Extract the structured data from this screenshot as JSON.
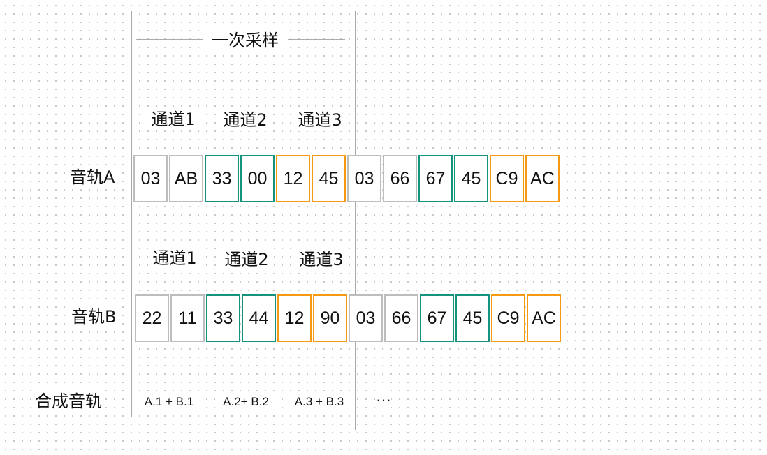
{
  "title": "一次采样",
  "channels": [
    "通道1",
    "通道2",
    "通道3"
  ],
  "tracks": [
    {
      "label": "音轨A",
      "cells": [
        {
          "value": "03",
          "channel": 1
        },
        {
          "value": "AB",
          "channel": 1
        },
        {
          "value": "33",
          "channel": 2
        },
        {
          "value": "00",
          "channel": 2
        },
        {
          "value": "12",
          "channel": 3
        },
        {
          "value": "45",
          "channel": 3
        },
        {
          "value": "03",
          "channel": 1
        },
        {
          "value": "66",
          "channel": 1
        },
        {
          "value": "67",
          "channel": 2
        },
        {
          "value": "45",
          "channel": 2
        },
        {
          "value": "C9",
          "channel": 3
        },
        {
          "value": "AC",
          "channel": 3
        }
      ]
    },
    {
      "label": "音轨B",
      "cells": [
        {
          "value": "22",
          "channel": 1
        },
        {
          "value": "11",
          "channel": 1
        },
        {
          "value": "33",
          "channel": 2
        },
        {
          "value": "44",
          "channel": 2
        },
        {
          "value": "12",
          "channel": 3
        },
        {
          "value": "90",
          "channel": 3
        },
        {
          "value": "03",
          "channel": 1
        },
        {
          "value": "66",
          "channel": 1
        },
        {
          "value": "67",
          "channel": 2
        },
        {
          "value": "45",
          "channel": 2
        },
        {
          "value": "C9",
          "channel": 3
        },
        {
          "value": "AC",
          "channel": 3
        }
      ]
    }
  ],
  "mixed": {
    "label": "合成音轨",
    "items": [
      "A.1 + B.1",
      "A.2+ B.2",
      "A.3 + B.3"
    ],
    "ellipsis": "···"
  },
  "colors": {
    "channel1": "#bdbdbd",
    "channel2": "#14937f",
    "channel3": "#f59a12",
    "divider": "#aaaaaa"
  }
}
